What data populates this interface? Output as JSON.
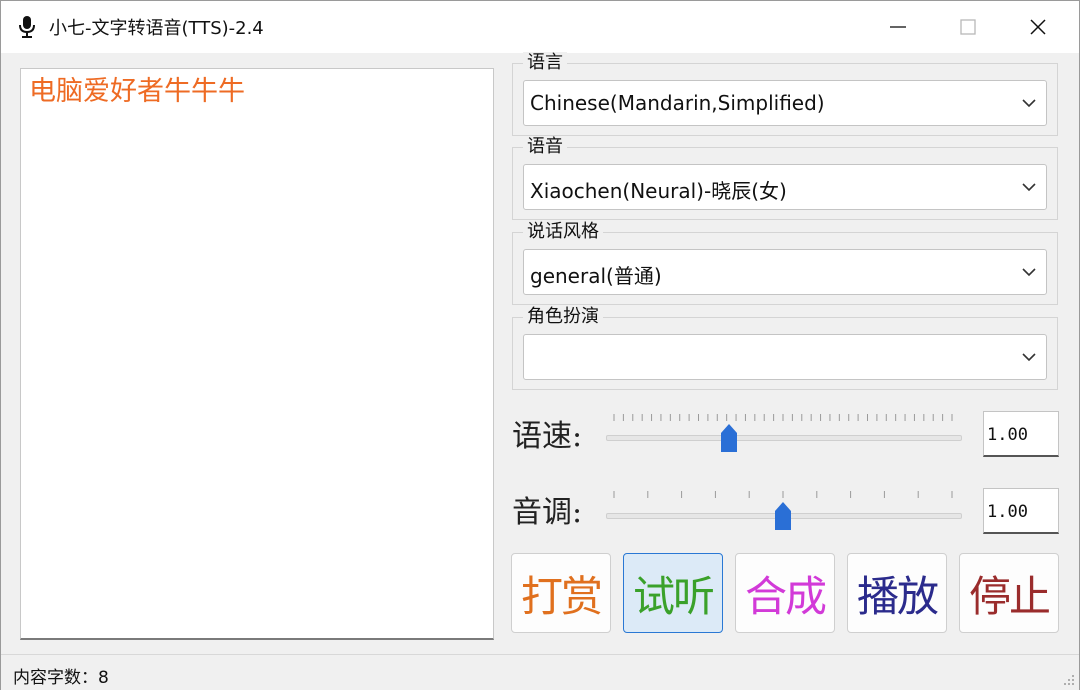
{
  "window": {
    "title": "小七-文字转语音(TTS)-2.4",
    "controls": {
      "minimize": "minimize-icon",
      "maximize": "maximize-icon",
      "close": "close-icon"
    }
  },
  "editor": {
    "text": "电脑爱好者牛牛牛",
    "text_color": "#ee6b24"
  },
  "settings": {
    "language": {
      "label": "语言",
      "value": "Chinese(Mandarin,Simplified)"
    },
    "voice": {
      "label": "语音",
      "value": "Xiaochen(Neural)-晓辰(女)"
    },
    "style": {
      "label": "说话风格",
      "value": "general(普通)"
    },
    "role": {
      "label": "角色扮演",
      "value": ""
    }
  },
  "sliders": {
    "rate": {
      "label": "语速:",
      "value": "1.00",
      "position_fraction": 0.34
    },
    "pitch": {
      "label": "音调:",
      "value": "1.00",
      "position_fraction": 0.5
    }
  },
  "buttons": {
    "tip": {
      "label": "打赏",
      "color": "#e0701e"
    },
    "preview": {
      "label": "试听",
      "color": "#3aa12a"
    },
    "synthesize": {
      "label": "合成",
      "color": "#d23ad8"
    },
    "play": {
      "label": "播放",
      "color": "#2b2b8c"
    },
    "stop": {
      "label": "停止",
      "color": "#9a2c2c"
    }
  },
  "status": {
    "text": "内容字数：8"
  }
}
